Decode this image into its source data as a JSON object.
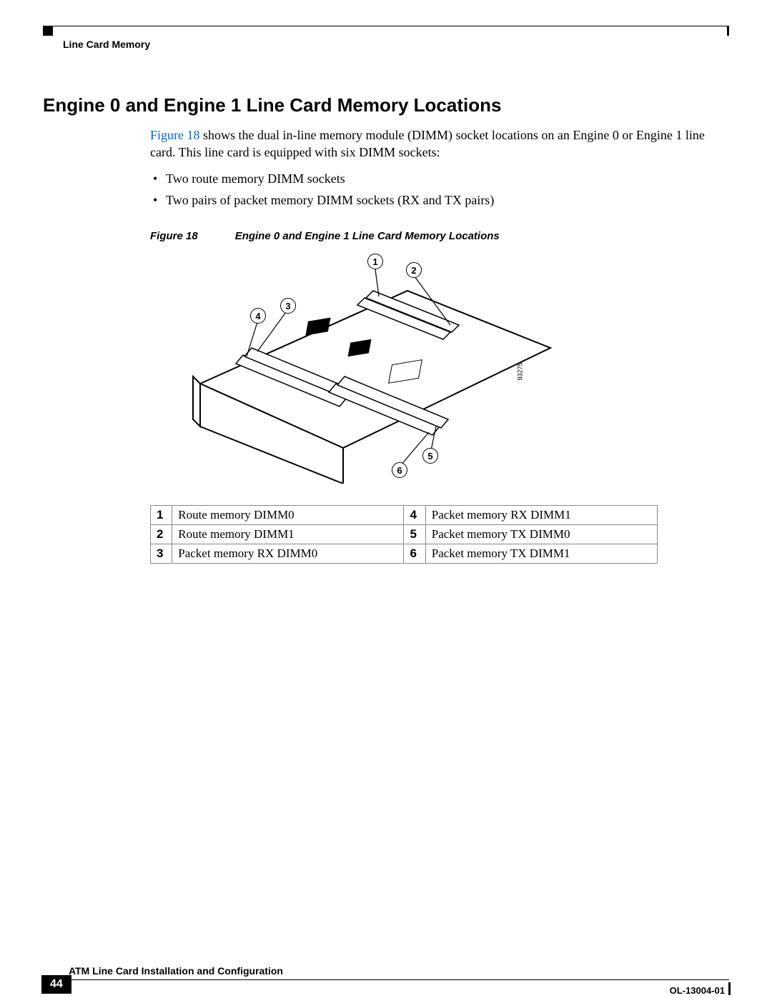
{
  "running_head": "Line Card Memory",
  "section_title": "Engine 0 and Engine 1 Line Card Memory Locations",
  "intro": {
    "figref": "Figure 18",
    "rest": " shows the dual in-line memory module (DIMM) socket locations on an Engine 0 or Engine 1 line card. This line card is equipped with six DIMM sockets:"
  },
  "bullets": [
    "Two route memory DIMM sockets",
    "Two pairs of packet memory DIMM sockets (RX and TX pairs)"
  ],
  "figure": {
    "label": "Figure 18",
    "caption": "Engine 0 and Engine 1 Line Card Memory Locations",
    "art_number": "93275",
    "callouts": [
      "1",
      "2",
      "3",
      "4",
      "5",
      "6"
    ]
  },
  "key_table": [
    {
      "n": "1",
      "d": "Route memory DIMM0",
      "n2": "4",
      "d2": "Packet memory RX DIMM1"
    },
    {
      "n": "2",
      "d": "Route memory DIMM1",
      "n2": "5",
      "d2": "Packet memory TX DIMM0"
    },
    {
      "n": "3",
      "d": "Packet memory RX DIMM0",
      "n2": "6",
      "d2": "Packet memory TX DIMM1"
    }
  ],
  "footer": {
    "title": "ATM Line Card Installation and Configuration",
    "page": "44",
    "doc_id": "OL-13004-01"
  }
}
